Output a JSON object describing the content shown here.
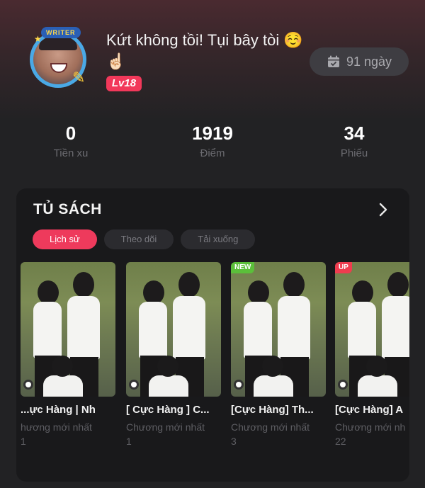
{
  "profile": {
    "username": "Kứt không tồi! Tụi bây tòi ☺️☝🏻",
    "avatar_badge": "WRITER",
    "level": "Lv18",
    "days": "91 ngày"
  },
  "stats": [
    {
      "value": "0",
      "label": "Tiền xu"
    },
    {
      "value": "1919",
      "label": "Điểm"
    },
    {
      "value": "34",
      "label": "Phiếu"
    }
  ],
  "shelf": {
    "title": "TỦ SÁCH",
    "tabs": [
      "Lịch sử",
      "Theo dõi",
      "Tải xuống"
    ],
    "active_tab": "Lịch sử",
    "books": [
      {
        "title": "ực Hàng | Nh...",
        "subtitle": "hương mới nhất",
        "chapter": "1",
        "tag": ""
      },
      {
        "title": "[ Cực Hàng ] C...",
        "subtitle": "Chương mới nhất",
        "chapter": "1",
        "tag": ""
      },
      {
        "title": "[Cực Hàng] Th...",
        "subtitle": "Chương mới nhất",
        "chapter": "3",
        "tag": "NEW"
      },
      {
        "title": "[Cực Hàng] A",
        "subtitle": "Chương mới nh",
        "chapter": "22",
        "tag": "UP"
      }
    ]
  },
  "colors": {
    "accent": "#ee3a5c",
    "level_badge": "#f2385a",
    "new_tag": "#5bbf3a",
    "up_tag": "#ef3c4f"
  }
}
